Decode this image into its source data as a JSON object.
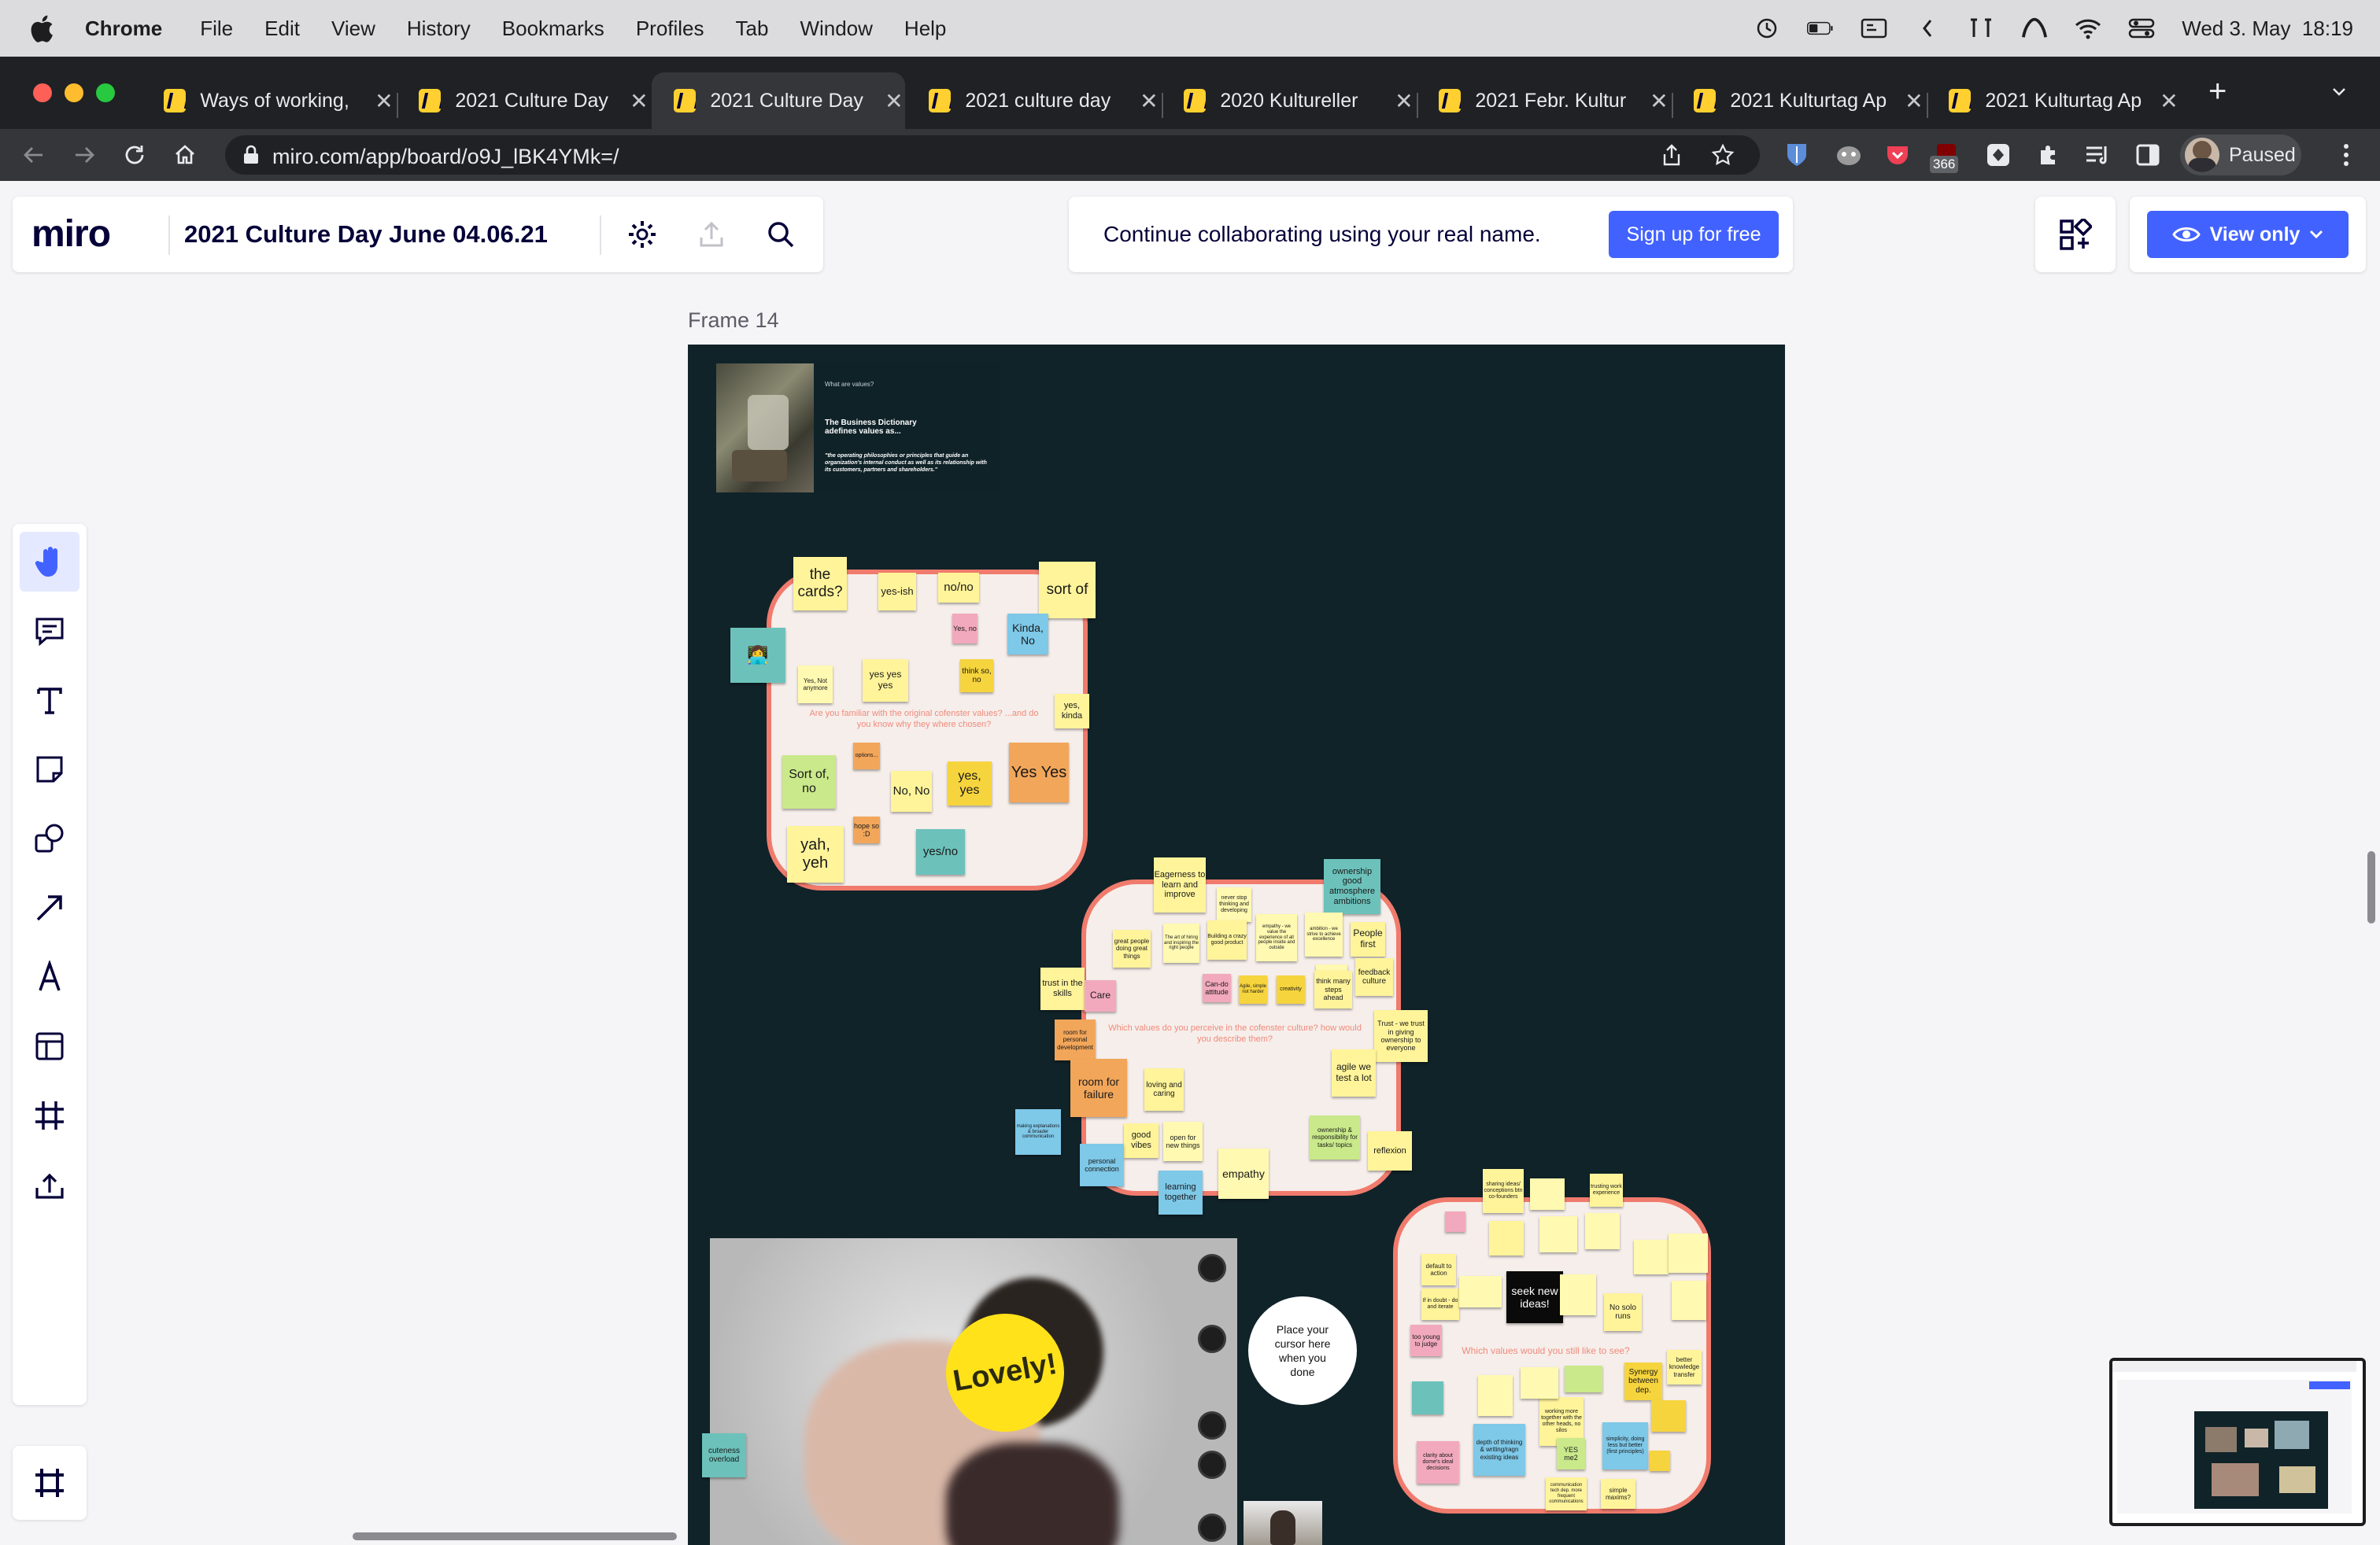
{
  "menubar": {
    "app": "Chrome",
    "items": [
      "File",
      "Edit",
      "View",
      "History",
      "Bookmarks",
      "Profiles",
      "Tab",
      "Window",
      "Help"
    ],
    "datetime": "Wed 3. May  18:19"
  },
  "tabs": [
    {
      "label": "Ways of working,"
    },
    {
      "label": "2021 Culture Day"
    },
    {
      "label": "2021 Culture Day"
    },
    {
      "label": "2021 culture day"
    },
    {
      "label": "2020 Kultureller"
    },
    {
      "label": "2021 Febr. Kultur"
    },
    {
      "label": "2021 Kulturtag Ap"
    },
    {
      "label": "2021 Kulturtag Ap"
    }
  ],
  "browser": {
    "url": "miro.com/app/board/o9J_lBK4YMk=/",
    "ext_badge": "366",
    "profile_label": "Paused"
  },
  "miro": {
    "logo": "miro",
    "board_title": "2021 Culture Day June 04.06.21",
    "collab_message": "Continue collaborating using your real name.",
    "signup_label": "Sign up for free",
    "view_only_label": "View only",
    "frame_title": "Frame 14"
  },
  "slide": {
    "kicker": "What are values?",
    "heading": "The Business Dictionary adefines values as...",
    "quote": "\"the operating philosophies or principles that guide an organization's internal conduct as well as its relationship with its customers, partners and shareholders.\""
  },
  "clusters": {
    "c1_question": "Are you familiar with the original cofenster values? ...and do you know why they where chosen?",
    "c2_question": "Which values do you perceive in the cofenster culture? how would you describe them?",
    "c3_question": "Which values would you still like to see?"
  },
  "stickies_c1": [
    "the cards?",
    "yes-ish",
    "no/no",
    "Yes, no",
    "sort of",
    "Kinda, No",
    "Yes, Not anymore",
    "yes yes yes",
    "think so, no",
    "yes, kinda",
    "Sort of, no",
    "options...",
    "No, No",
    "yes, yes",
    "Yes Yes",
    "hope so :D",
    "yah, yeh",
    "yes/no"
  ],
  "stickies_c2": [
    "Eagerness to learn and improve",
    "never stop thinking and developing",
    "ownership good atmosphere ambitions",
    "great people doing great things",
    "The art of hiring and inspiring the right people",
    "Building a crazy good product",
    "empathy - we value the experience of all people inside and outside",
    "ambition - we strive to achieve excellence",
    "People first",
    "foresight",
    "feedback culture",
    "trust in the skills",
    "Care",
    "Can-do attitude",
    "Agile, simple not harder",
    "creativity",
    "think many steps ahead",
    "Trust - we trust in giving ownership to everyone",
    "room for personal development",
    "agile we test a lot",
    "room for failure",
    "loving and caring",
    "good vibes",
    "open for new things",
    "ownership & responsibility for tasks/ topics",
    "reflexion",
    "making explanations & broader communication",
    "personal connection",
    "empathy",
    "learning together"
  ],
  "stickies_c3": [
    "sharing ideas/ conceptions btn co-founders",
    "trusting work experience",
    "default to action",
    "If in doubt - do and iterate",
    "seek new ideas!",
    "No solo runs",
    "too young to judge",
    "Synergy between dep.",
    "better knowledge transfer",
    "depth of thinking & writing/ragn existing ideas",
    "clarity about dome's ideal decisions",
    "working more together with the other heads, no silos",
    "YES me2",
    "simplicity, doing less but better (first principles)",
    "communication tech dep. more frequent communications",
    "simple maxims?"
  ],
  "video": {
    "sticker": "Lovely!",
    "note": "cuteness overload"
  },
  "cursor_circle": "Place your cursor here when you done",
  "colors": {
    "miro_blue": "#4262ff",
    "frame_bg": "#102329",
    "cluster_border": "#f07b6d",
    "sticky_yellow": "#fff49a",
    "sticky_light_yellow": "#fff9b1",
    "sticky_orange": "#f2a65a",
    "sticky_blue": "#7ec8e8",
    "sticky_teal": "#6cc2bb",
    "sticky_green": "#c9e98a",
    "sticky_pink": "#f2a9bd"
  }
}
